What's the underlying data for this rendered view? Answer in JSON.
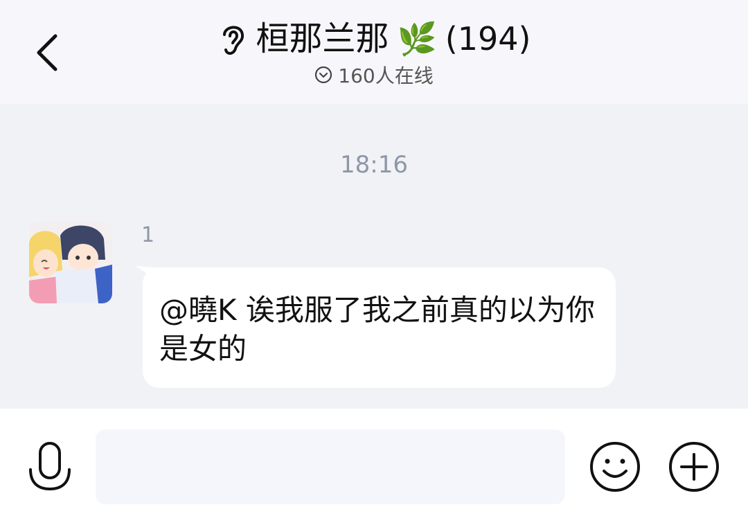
{
  "header": {
    "title": "桓那兰那",
    "leaf_emoji": "🌿",
    "member_count": "(194)",
    "online_status": "160人在线",
    "back_icon": "back-arrow-icon",
    "ear_icon": "ear-icon"
  },
  "chat": {
    "timestamp": "18:16",
    "messages": [
      {
        "sender": "1",
        "avatar": "anime-avatar",
        "text": "@曉K 诶我服了我之前真的以为你是女的"
      }
    ]
  },
  "input_bar": {
    "voice_icon": "microphone-icon",
    "placeholder": "",
    "emoji_icon": "smiley-icon",
    "plus_icon": "plus-circle-icon"
  },
  "colors": {
    "header_bg": "#f7f7fb",
    "chat_bg": "#f1f2f6",
    "bubble_bg": "#ffffff",
    "muted_text": "#8f96a6"
  }
}
